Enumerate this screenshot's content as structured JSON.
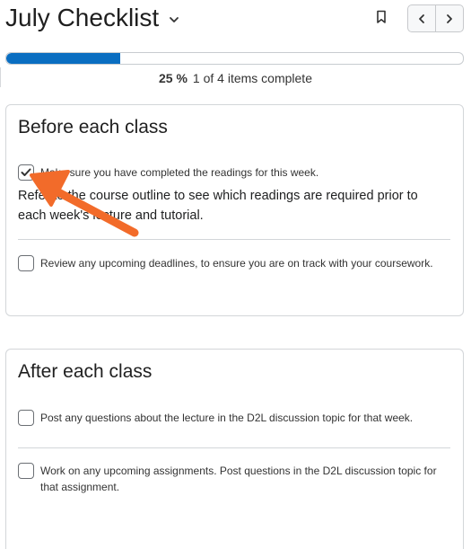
{
  "header": {
    "title": "July Checklist",
    "icons": {
      "title_menu": "chevron-down-icon",
      "bookmark": "bookmark-icon",
      "prev": "chevron-left-icon",
      "next": "chevron-right-icon"
    }
  },
  "progress": {
    "percent_label": "25 %",
    "summary": "1 of 4 items complete",
    "fraction": 0.25,
    "fill_color": "#0a6ec1"
  },
  "sections": [
    {
      "title": "Before each class",
      "items": [
        {
          "label": "Make sure you have completed the readings for this week.",
          "checked": true,
          "description": "Refer to the course outline to see which readings are required prior to each week's lecture and tutorial."
        },
        {
          "label": "Review any upcoming deadlines, to ensure you are on track with your coursework.",
          "checked": false
        }
      ]
    },
    {
      "title": "After each class",
      "items": [
        {
          "label": "Post any questions about the lecture in the D2L discussion topic for that week.",
          "checked": false
        },
        {
          "label": "Work on any upcoming assignments. Post questions in the D2L discussion topic for that assignment.",
          "checked": false
        }
      ]
    }
  ],
  "annotation": {
    "arrow_color": "#f26b2a"
  }
}
